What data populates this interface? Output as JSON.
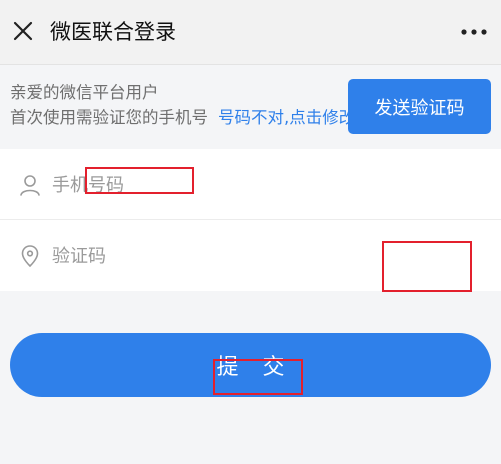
{
  "header": {
    "title": "微医联合登录",
    "close_icon": "close-icon",
    "more_icon": "more-dots-icon"
  },
  "info": {
    "greeting": "亲爱的微信平台用户",
    "verify_text": "首次使用需验证您的手机号",
    "edit_link": "号码不对,点击修改"
  },
  "form": {
    "phone_placeholder": "手机号码",
    "phone_icon": "user-icon",
    "code_placeholder": "验证码",
    "code_icon": "location-pin-icon",
    "send_code_label": "发送验证码"
  },
  "submit_label": "提交",
  "colors": {
    "accent": "#2f80ea",
    "annotation": "#e3202d",
    "background": "#f4f5f7"
  }
}
